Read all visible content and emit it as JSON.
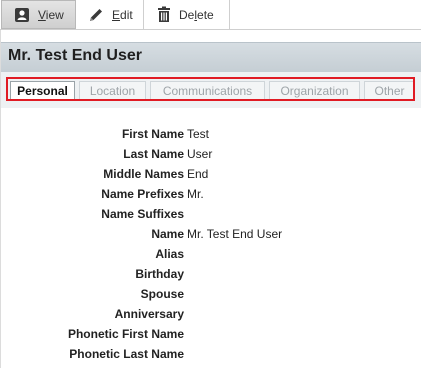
{
  "toolbar": {
    "view_label": "View",
    "view_key": "V",
    "view_rest": "iew",
    "edit_key": "E",
    "edit_rest": "dit",
    "delete_pre": "De",
    "delete_key": "l",
    "delete_rest": "ete"
  },
  "header": {
    "title": "Mr. Test End User"
  },
  "tabs": [
    {
      "label": "Personal",
      "selected": true
    },
    {
      "label": "Location",
      "selected": false
    },
    {
      "label": "Communications",
      "selected": false
    },
    {
      "label": "Organization",
      "selected": false
    },
    {
      "label": "Other",
      "selected": false
    }
  ],
  "fields": [
    {
      "label": "First Name",
      "value": "Test"
    },
    {
      "label": "Last Name",
      "value": "User"
    },
    {
      "label": "Middle Names",
      "value": "End"
    },
    {
      "label": "Name Prefixes",
      "value": "Mr."
    },
    {
      "label": "Name Suffixes",
      "value": ""
    },
    {
      "label": "Name",
      "value": "Mr. Test End User"
    },
    {
      "label": "Alias",
      "value": ""
    },
    {
      "label": "Birthday",
      "value": ""
    },
    {
      "label": "Spouse",
      "value": ""
    },
    {
      "label": "Anniversary",
      "value": ""
    },
    {
      "label": "Phonetic First Name",
      "value": ""
    },
    {
      "label": "Phonetic Last Name",
      "value": ""
    }
  ],
  "colors": {
    "highlight_outline": "#e01b24",
    "header_band": "#c9d1d7"
  },
  "icons": {
    "view": "contact-card-icon",
    "edit": "pencil-icon",
    "delete": "trash-icon"
  }
}
